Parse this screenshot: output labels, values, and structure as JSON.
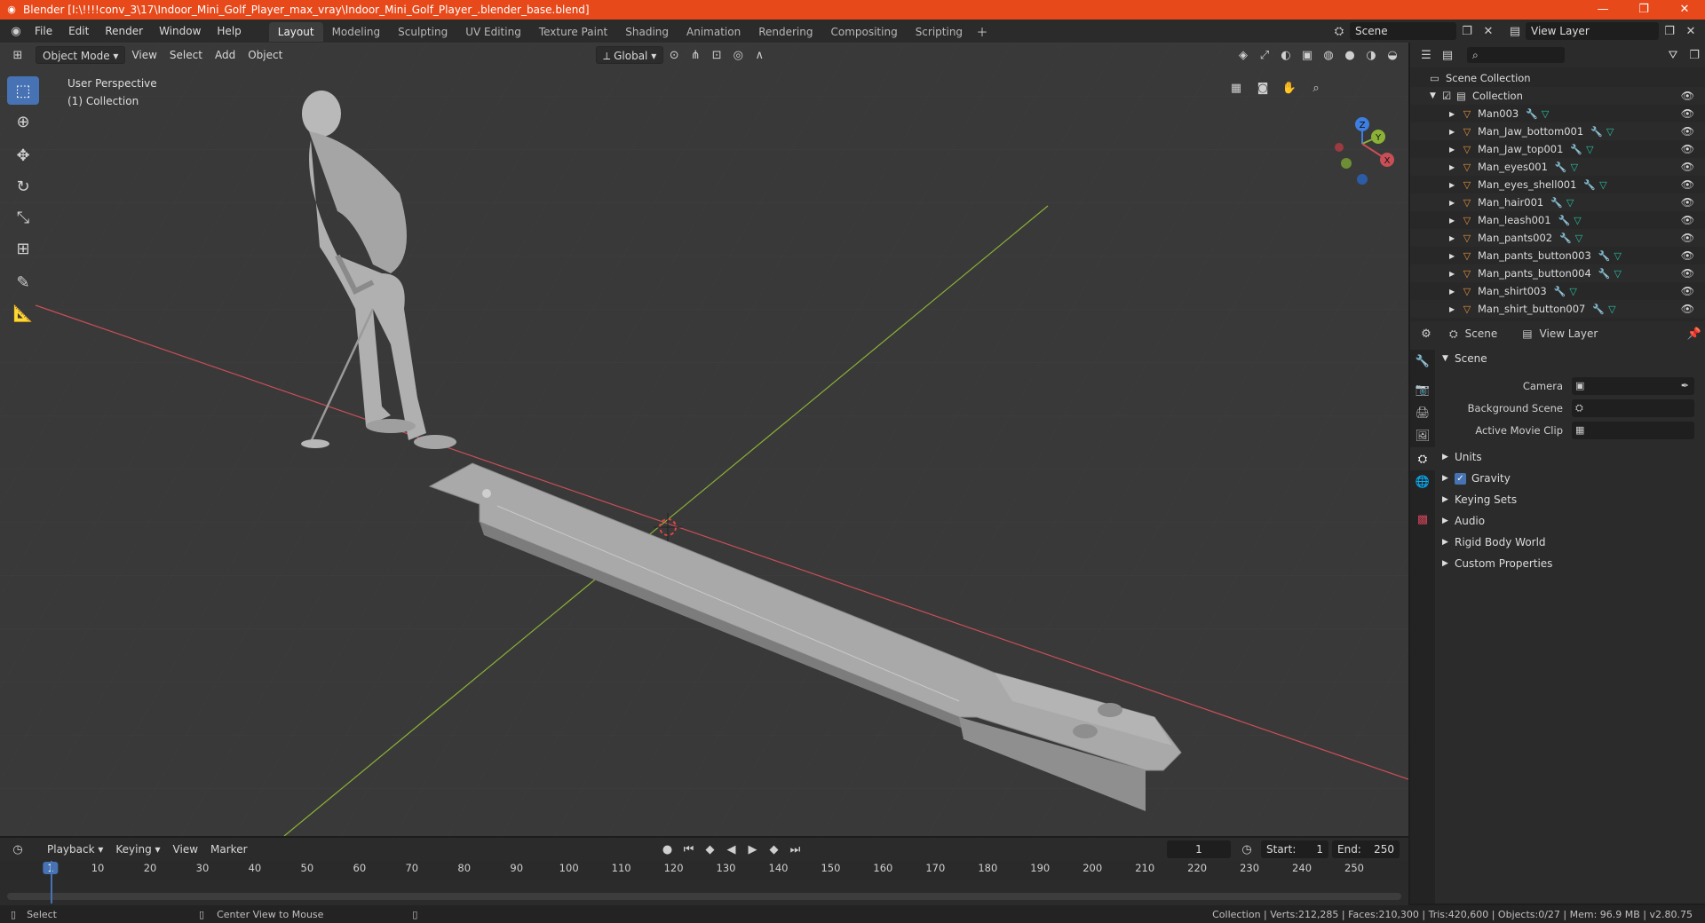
{
  "window": {
    "title": "Blender [I:\\!!!!conv_3\\17\\Indoor_Mini_Golf_Player_max_vray\\Indoor_Mini_Golf_Player_.blender_base.blend]",
    "min_label": "—",
    "max_label": "❐",
    "close_label": "✕"
  },
  "menu": [
    "File",
    "Edit",
    "Render",
    "Window",
    "Help"
  ],
  "workspaces": [
    "Layout",
    "Modeling",
    "Sculpting",
    "UV Editing",
    "Texture Paint",
    "Shading",
    "Animation",
    "Rendering",
    "Compositing",
    "Scripting"
  ],
  "scene_field": "Scene",
  "view_layer_field": "View Layer",
  "viewport": {
    "mode": "Object Mode",
    "menus": [
      "View",
      "Select",
      "Add",
      "Object"
    ],
    "transform": "Global",
    "perspective_label": "User Perspective",
    "collection_label": "(1) Collection",
    "gizmo": {
      "x": "X",
      "y": "Y",
      "z": "Z"
    }
  },
  "outliner": {
    "root": "Scene Collection",
    "collection": "Collection",
    "items": [
      "Man003",
      "Man_Jaw_bottom001",
      "Man_Jaw_top001",
      "Man_eyes001",
      "Man_eyes_shell001",
      "Man_hair001",
      "Man_leash001",
      "Man_pants002",
      "Man_pants_button003",
      "Man_pants_button004",
      "Man_shirt003",
      "Man_shirt_button007"
    ]
  },
  "properties": {
    "breadcrumb_scene": "Scene",
    "breadcrumb_view_layer": "View Layer",
    "section_scene": "Scene",
    "fields": [
      {
        "label": "Camera"
      },
      {
        "label": "Background Scene"
      },
      {
        "label": "Active Movie Clip"
      }
    ],
    "sections": [
      "Units",
      "Gravity",
      "Keying Sets",
      "Audio",
      "Rigid Body World",
      "Custom Properties"
    ]
  },
  "timeline": {
    "menus": [
      "Playback",
      "Keying",
      "View",
      "Marker"
    ],
    "current_frame": "1",
    "start_label": "Start:",
    "start": "1",
    "end_label": "End:",
    "end": "250",
    "ticks": [
      "1",
      "10",
      "20",
      "30",
      "40",
      "50",
      "60",
      "70",
      "80",
      "90",
      "100",
      "110",
      "120",
      "130",
      "140",
      "150",
      "160",
      "170",
      "180",
      "190",
      "200",
      "210",
      "220",
      "230",
      "240",
      "250"
    ]
  },
  "statusbar": {
    "left": "Select",
    "middle": "Center View to Mouse",
    "right": "Collection | Verts:212,285 | Faces:210,300 | Tris:420,600 | Objects:0/27 | Mem: 96.9 MB | v2.80.75"
  },
  "colors": {
    "titlebar": "#e8491b",
    "active_tool": "#4772b3",
    "x_axis": "#c94f57",
    "y_axis": "#8bb236",
    "z_axis": "#3d7ee0"
  }
}
